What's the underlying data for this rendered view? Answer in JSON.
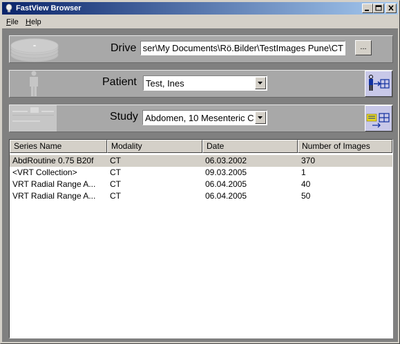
{
  "window": {
    "title": "FastView Browser"
  },
  "menu": [
    {
      "label_ul": "F",
      "label_rest": "ile"
    },
    {
      "label_ul": "H",
      "label_rest": "elp"
    }
  ],
  "drive": {
    "label": "Drive",
    "path": "ser\\My Documents\\Rö.Bilder\\TestImages Pune\\CT",
    "browse_label": "..."
  },
  "patient": {
    "label": "Patient",
    "selected": "Test, Ines"
  },
  "study": {
    "label": "Study",
    "selected": "Abdomen, 10 Mesenteric C"
  },
  "series_table": {
    "columns": [
      "Series Name",
      "Modality",
      "Date",
      "Number of Images"
    ],
    "rows": [
      {
        "name": "AbdRoutine  0.75  B20f",
        "modality": "CT",
        "date": "06.03.2002",
        "count": "370"
      },
      {
        "name": "<VRT Collection>",
        "modality": "CT",
        "date": "09.03.2005",
        "count": "1"
      },
      {
        "name": "VRT Radial Range A...",
        "modality": "CT",
        "date": "06.04.2005",
        "count": "40"
      },
      {
        "name": "VRT Radial Range A...",
        "modality": "CT",
        "date": "06.04.2005",
        "count": "50"
      }
    ]
  },
  "colors": {
    "titlebar_start": "#0a246a",
    "titlebar_end": "#a6caf0",
    "panel": "#a8a8a8",
    "selected_row": "#d4d0c8"
  }
}
